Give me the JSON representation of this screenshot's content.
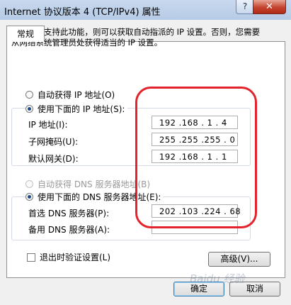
{
  "window": {
    "title": "Internet 协议版本 4 (TCP/IPv4) 属性",
    "help_label": "?",
    "close_label": "✕"
  },
  "tab": {
    "general": "常规"
  },
  "description": "如果网络支持此功能，则可以获取自动指派的 IP 设置。否则，您需要从网络系统管理员处获得适当的 IP 设置。",
  "ip": {
    "auto_label": "自动获得 IP 地址(O)",
    "manual_label": "使用下面的 IP 地址(S):",
    "address_label": "IP 地址(I):",
    "address_value": "192 .168 . 1 . 4",
    "mask_label": "子网掩码(U):",
    "mask_value": "255 .255 .255 . 0",
    "gateway_label": "默认网关(D):",
    "gateway_value": "192 .168 . 1 . 1"
  },
  "dns": {
    "auto_label": "自动获得 DNS 服务器地址(B)",
    "manual_label": "使用下面的 DNS 服务器地址(E):",
    "preferred_label": "首选 DNS 服务器(P):",
    "preferred_value": "202 .103 .224 . 68",
    "alternate_label": "备用 DNS 服务器(A):",
    "alternate_value": ""
  },
  "validate_label": "退出时验证设置(L)",
  "advanced_label": "高级(V)...",
  "ok_label": "确定",
  "cancel_label": "取消",
  "watermark_text": "Baidu 经验",
  "colors": {
    "annotation": "#e3232c",
    "accent": "#1b4a86"
  }
}
